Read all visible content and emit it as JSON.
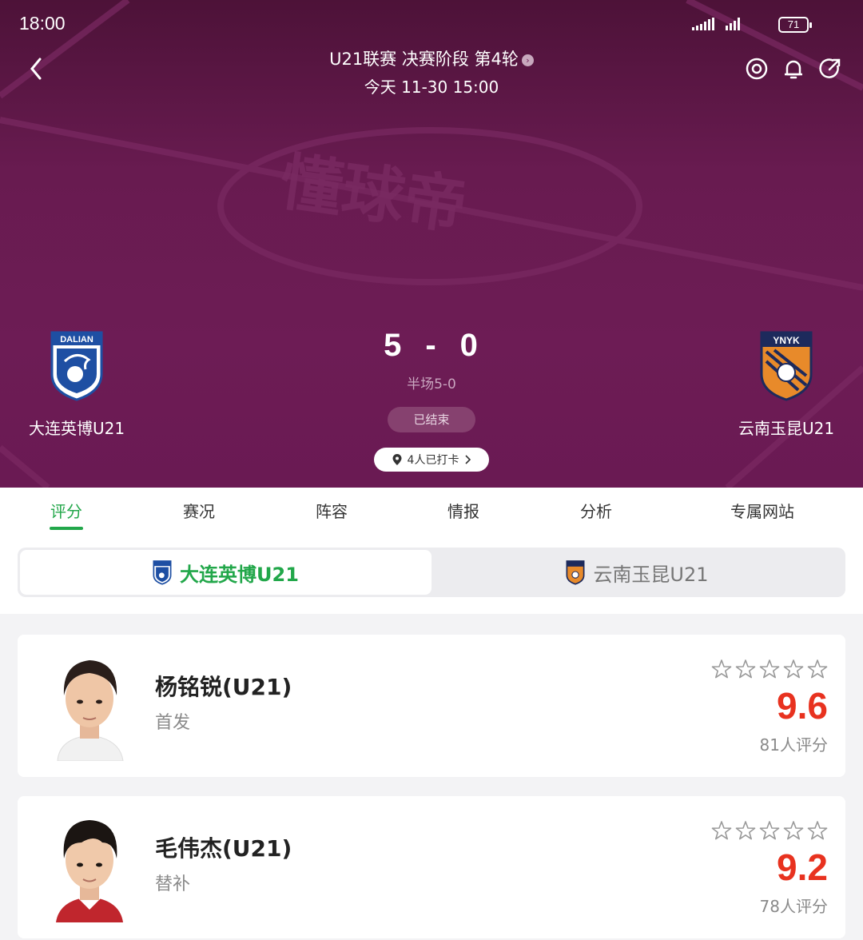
{
  "status_bar": {
    "time": "18:00",
    "battery": "71"
  },
  "header": {
    "competition": "U21联赛 决赛阶段 第4轮",
    "match_time": "今天 11-30 15:00"
  },
  "match": {
    "home_team": "大连英博U21",
    "away_team": "云南玉昆U21",
    "home_score": "5",
    "away_score": "0",
    "score_separator": "-",
    "halftime": "半场5-0",
    "status": "已结束",
    "checkin": "4人已打卡"
  },
  "tabs": [
    {
      "label": "评分"
    },
    {
      "label": "赛况"
    },
    {
      "label": "阵容"
    },
    {
      "label": "情报"
    },
    {
      "label": "分析"
    },
    {
      "label": "专属网站"
    }
  ],
  "team_switch": {
    "selected": "大连英博U21",
    "other": "云南玉昆U21"
  },
  "players": [
    {
      "name": "杨铭锐(U21)",
      "role": "首发",
      "rating": "9.6",
      "votes": "81人评分"
    },
    {
      "name": "毛伟杰(U21)",
      "role": "替补",
      "rating": "9.2",
      "votes": "78人评分"
    }
  ],
  "colors": {
    "accent": "#22a74a",
    "rating": "#e8321f",
    "header_bg": "#6d1c55"
  },
  "crest_text": {
    "home": "DALIAN",
    "away": "YNYK"
  }
}
